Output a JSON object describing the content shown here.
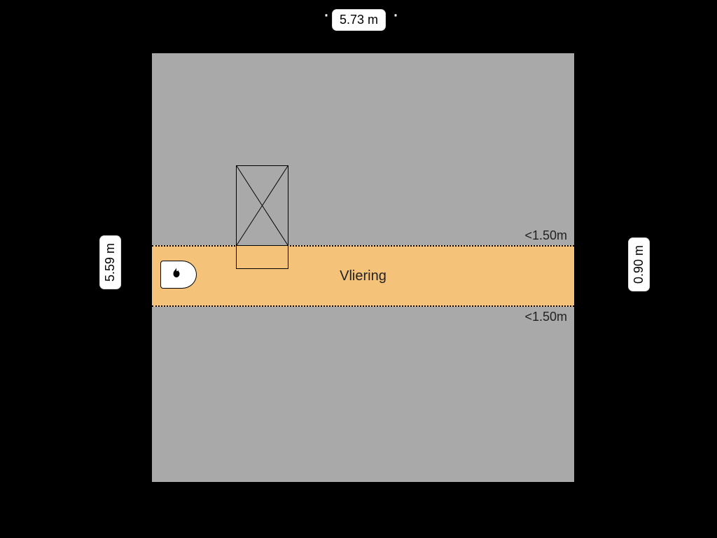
{
  "dimensions": {
    "width_label": "5.73 m",
    "height_label": "5.59 m",
    "strip_height_label": "0.90 m"
  },
  "room": {
    "name": "Vliering",
    "ceiling_note_top": "<1.50m",
    "ceiling_note_bottom": "<1.50m"
  },
  "features": {
    "stair_opening": "stair-opening",
    "boiler": "boiler"
  }
}
